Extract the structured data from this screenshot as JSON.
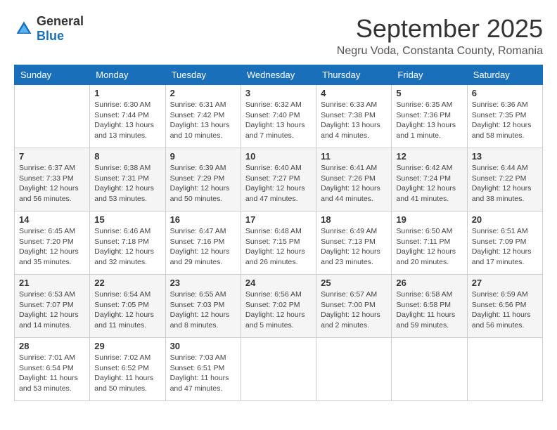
{
  "header": {
    "logo": {
      "general": "General",
      "blue": "Blue"
    },
    "month_title": "September 2025",
    "location": "Negru Voda, Constanta County, Romania"
  },
  "weekdays": [
    "Sunday",
    "Monday",
    "Tuesday",
    "Wednesday",
    "Thursday",
    "Friday",
    "Saturday"
  ],
  "weeks": [
    [
      {
        "day": "",
        "sunrise": "",
        "sunset": "",
        "daylight": ""
      },
      {
        "day": "1",
        "sunrise": "Sunrise: 6:30 AM",
        "sunset": "Sunset: 7:44 PM",
        "daylight": "Daylight: 13 hours and 13 minutes."
      },
      {
        "day": "2",
        "sunrise": "Sunrise: 6:31 AM",
        "sunset": "Sunset: 7:42 PM",
        "daylight": "Daylight: 13 hours and 10 minutes."
      },
      {
        "day": "3",
        "sunrise": "Sunrise: 6:32 AM",
        "sunset": "Sunset: 7:40 PM",
        "daylight": "Daylight: 13 hours and 7 minutes."
      },
      {
        "day": "4",
        "sunrise": "Sunrise: 6:33 AM",
        "sunset": "Sunset: 7:38 PM",
        "daylight": "Daylight: 13 hours and 4 minutes."
      },
      {
        "day": "5",
        "sunrise": "Sunrise: 6:35 AM",
        "sunset": "Sunset: 7:36 PM",
        "daylight": "Daylight: 13 hours and 1 minute."
      },
      {
        "day": "6",
        "sunrise": "Sunrise: 6:36 AM",
        "sunset": "Sunset: 7:35 PM",
        "daylight": "Daylight: 12 hours and 58 minutes."
      }
    ],
    [
      {
        "day": "7",
        "sunrise": "Sunrise: 6:37 AM",
        "sunset": "Sunset: 7:33 PM",
        "daylight": "Daylight: 12 hours and 56 minutes."
      },
      {
        "day": "8",
        "sunrise": "Sunrise: 6:38 AM",
        "sunset": "Sunset: 7:31 PM",
        "daylight": "Daylight: 12 hours and 53 minutes."
      },
      {
        "day": "9",
        "sunrise": "Sunrise: 6:39 AM",
        "sunset": "Sunset: 7:29 PM",
        "daylight": "Daylight: 12 hours and 50 minutes."
      },
      {
        "day": "10",
        "sunrise": "Sunrise: 6:40 AM",
        "sunset": "Sunset: 7:27 PM",
        "daylight": "Daylight: 12 hours and 47 minutes."
      },
      {
        "day": "11",
        "sunrise": "Sunrise: 6:41 AM",
        "sunset": "Sunset: 7:26 PM",
        "daylight": "Daylight: 12 hours and 44 minutes."
      },
      {
        "day": "12",
        "sunrise": "Sunrise: 6:42 AM",
        "sunset": "Sunset: 7:24 PM",
        "daylight": "Daylight: 12 hours and 41 minutes."
      },
      {
        "day": "13",
        "sunrise": "Sunrise: 6:44 AM",
        "sunset": "Sunset: 7:22 PM",
        "daylight": "Daylight: 12 hours and 38 minutes."
      }
    ],
    [
      {
        "day": "14",
        "sunrise": "Sunrise: 6:45 AM",
        "sunset": "Sunset: 7:20 PM",
        "daylight": "Daylight: 12 hours and 35 minutes."
      },
      {
        "day": "15",
        "sunrise": "Sunrise: 6:46 AM",
        "sunset": "Sunset: 7:18 PM",
        "daylight": "Daylight: 12 hours and 32 minutes."
      },
      {
        "day": "16",
        "sunrise": "Sunrise: 6:47 AM",
        "sunset": "Sunset: 7:16 PM",
        "daylight": "Daylight: 12 hours and 29 minutes."
      },
      {
        "day": "17",
        "sunrise": "Sunrise: 6:48 AM",
        "sunset": "Sunset: 7:15 PM",
        "daylight": "Daylight: 12 hours and 26 minutes."
      },
      {
        "day": "18",
        "sunrise": "Sunrise: 6:49 AM",
        "sunset": "Sunset: 7:13 PM",
        "daylight": "Daylight: 12 hours and 23 minutes."
      },
      {
        "day": "19",
        "sunrise": "Sunrise: 6:50 AM",
        "sunset": "Sunset: 7:11 PM",
        "daylight": "Daylight: 12 hours and 20 minutes."
      },
      {
        "day": "20",
        "sunrise": "Sunrise: 6:51 AM",
        "sunset": "Sunset: 7:09 PM",
        "daylight": "Daylight: 12 hours and 17 minutes."
      }
    ],
    [
      {
        "day": "21",
        "sunrise": "Sunrise: 6:53 AM",
        "sunset": "Sunset: 7:07 PM",
        "daylight": "Daylight: 12 hours and 14 minutes."
      },
      {
        "day": "22",
        "sunrise": "Sunrise: 6:54 AM",
        "sunset": "Sunset: 7:05 PM",
        "daylight": "Daylight: 12 hours and 11 minutes."
      },
      {
        "day": "23",
        "sunrise": "Sunrise: 6:55 AM",
        "sunset": "Sunset: 7:03 PM",
        "daylight": "Daylight: 12 hours and 8 minutes."
      },
      {
        "day": "24",
        "sunrise": "Sunrise: 6:56 AM",
        "sunset": "Sunset: 7:02 PM",
        "daylight": "Daylight: 12 hours and 5 minutes."
      },
      {
        "day": "25",
        "sunrise": "Sunrise: 6:57 AM",
        "sunset": "Sunset: 7:00 PM",
        "daylight": "Daylight: 12 hours and 2 minutes."
      },
      {
        "day": "26",
        "sunrise": "Sunrise: 6:58 AM",
        "sunset": "Sunset: 6:58 PM",
        "daylight": "Daylight: 11 hours and 59 minutes."
      },
      {
        "day": "27",
        "sunrise": "Sunrise: 6:59 AM",
        "sunset": "Sunset: 6:56 PM",
        "daylight": "Daylight: 11 hours and 56 minutes."
      }
    ],
    [
      {
        "day": "28",
        "sunrise": "Sunrise: 7:01 AM",
        "sunset": "Sunset: 6:54 PM",
        "daylight": "Daylight: 11 hours and 53 minutes."
      },
      {
        "day": "29",
        "sunrise": "Sunrise: 7:02 AM",
        "sunset": "Sunset: 6:52 PM",
        "daylight": "Daylight: 11 hours and 50 minutes."
      },
      {
        "day": "30",
        "sunrise": "Sunrise: 7:03 AM",
        "sunset": "Sunset: 6:51 PM",
        "daylight": "Daylight: 11 hours and 47 minutes."
      },
      {
        "day": "",
        "sunrise": "",
        "sunset": "",
        "daylight": ""
      },
      {
        "day": "",
        "sunrise": "",
        "sunset": "",
        "daylight": ""
      },
      {
        "day": "",
        "sunrise": "",
        "sunset": "",
        "daylight": ""
      },
      {
        "day": "",
        "sunrise": "",
        "sunset": "",
        "daylight": ""
      }
    ]
  ]
}
